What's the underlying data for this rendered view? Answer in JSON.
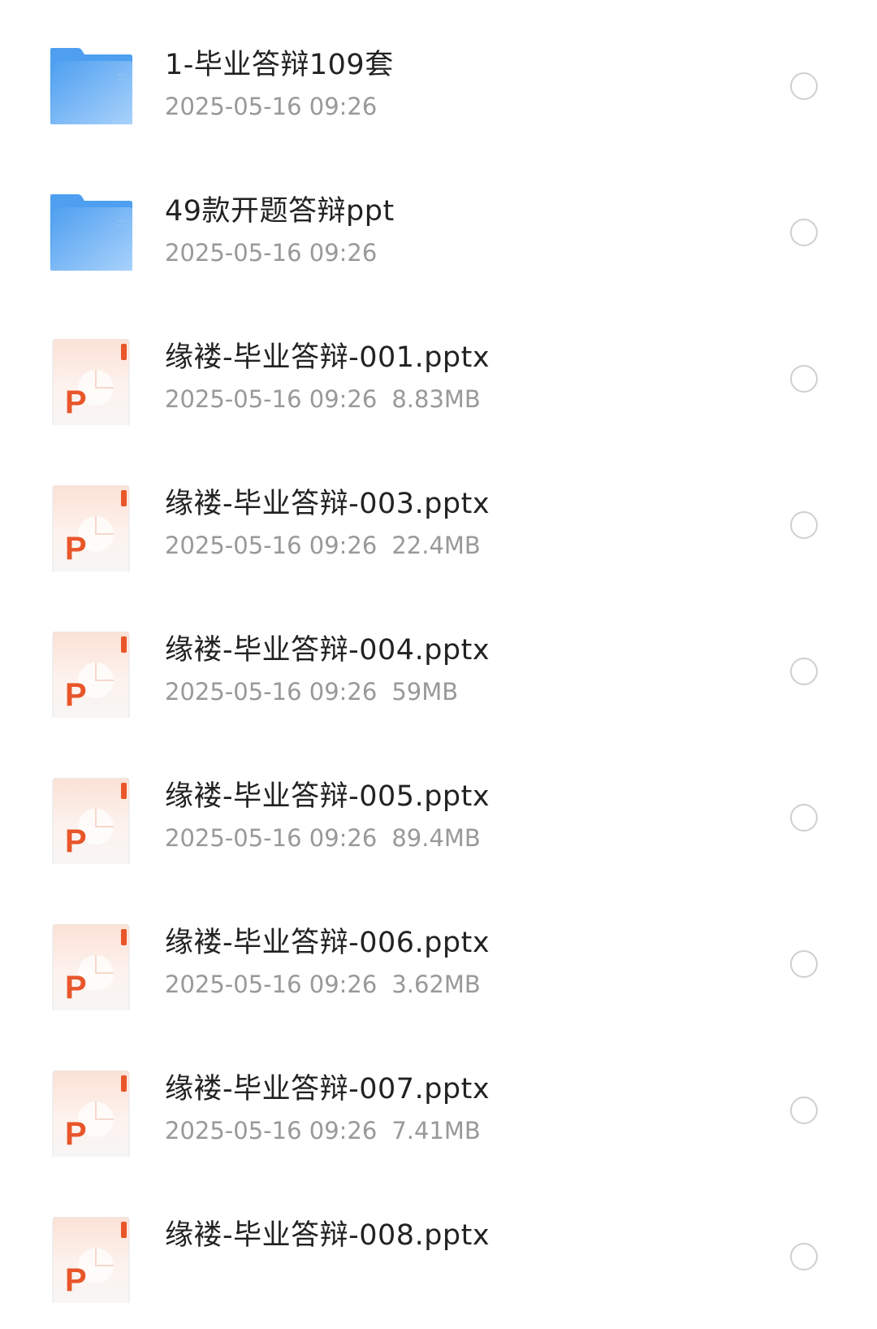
{
  "files": [
    {
      "name": "1-毕业答辩109套",
      "date": "2025-05-16 09:26",
      "size": "",
      "type": "folder",
      "icon": "folder-icon"
    },
    {
      "name": "49款开题答辩ppt",
      "date": "2025-05-16 09:26",
      "size": "",
      "type": "folder",
      "icon": "folder-icon"
    },
    {
      "name": "缘褛-毕业答辩-001.pptx",
      "date": "2025-05-16 09:26",
      "size": "8.83MB",
      "type": "pptx",
      "icon": "pptx-file-icon"
    },
    {
      "name": "缘褛-毕业答辩-003.pptx",
      "date": "2025-05-16 09:26",
      "size": "22.4MB",
      "type": "pptx",
      "icon": "pptx-file-icon"
    },
    {
      "name": "缘褛-毕业答辩-004.pptx",
      "date": "2025-05-16 09:26",
      "size": "59MB",
      "type": "pptx",
      "icon": "pptx-file-icon"
    },
    {
      "name": "缘褛-毕业答辩-005.pptx",
      "date": "2025-05-16 09:26",
      "size": "89.4MB",
      "type": "pptx",
      "icon": "pptx-file-icon"
    },
    {
      "name": "缘褛-毕业答辩-006.pptx",
      "date": "2025-05-16 09:26",
      "size": "3.62MB",
      "type": "pptx",
      "icon": "pptx-file-icon"
    },
    {
      "name": "缘褛-毕业答辩-007.pptx",
      "date": "2025-05-16 09:26",
      "size": "7.41MB",
      "type": "pptx",
      "icon": "pptx-file-icon"
    },
    {
      "name": "缘褛-毕业答辩-008.pptx",
      "date": "",
      "size": "",
      "type": "pptx",
      "icon": "pptx-file-icon"
    }
  ],
  "colors": {
    "folder_blue": "#5aa9f0",
    "pptx_orange": "#e8562a",
    "text_primary": "#222222",
    "text_secondary": "#999999",
    "circle_border": "#cfcfcf"
  }
}
